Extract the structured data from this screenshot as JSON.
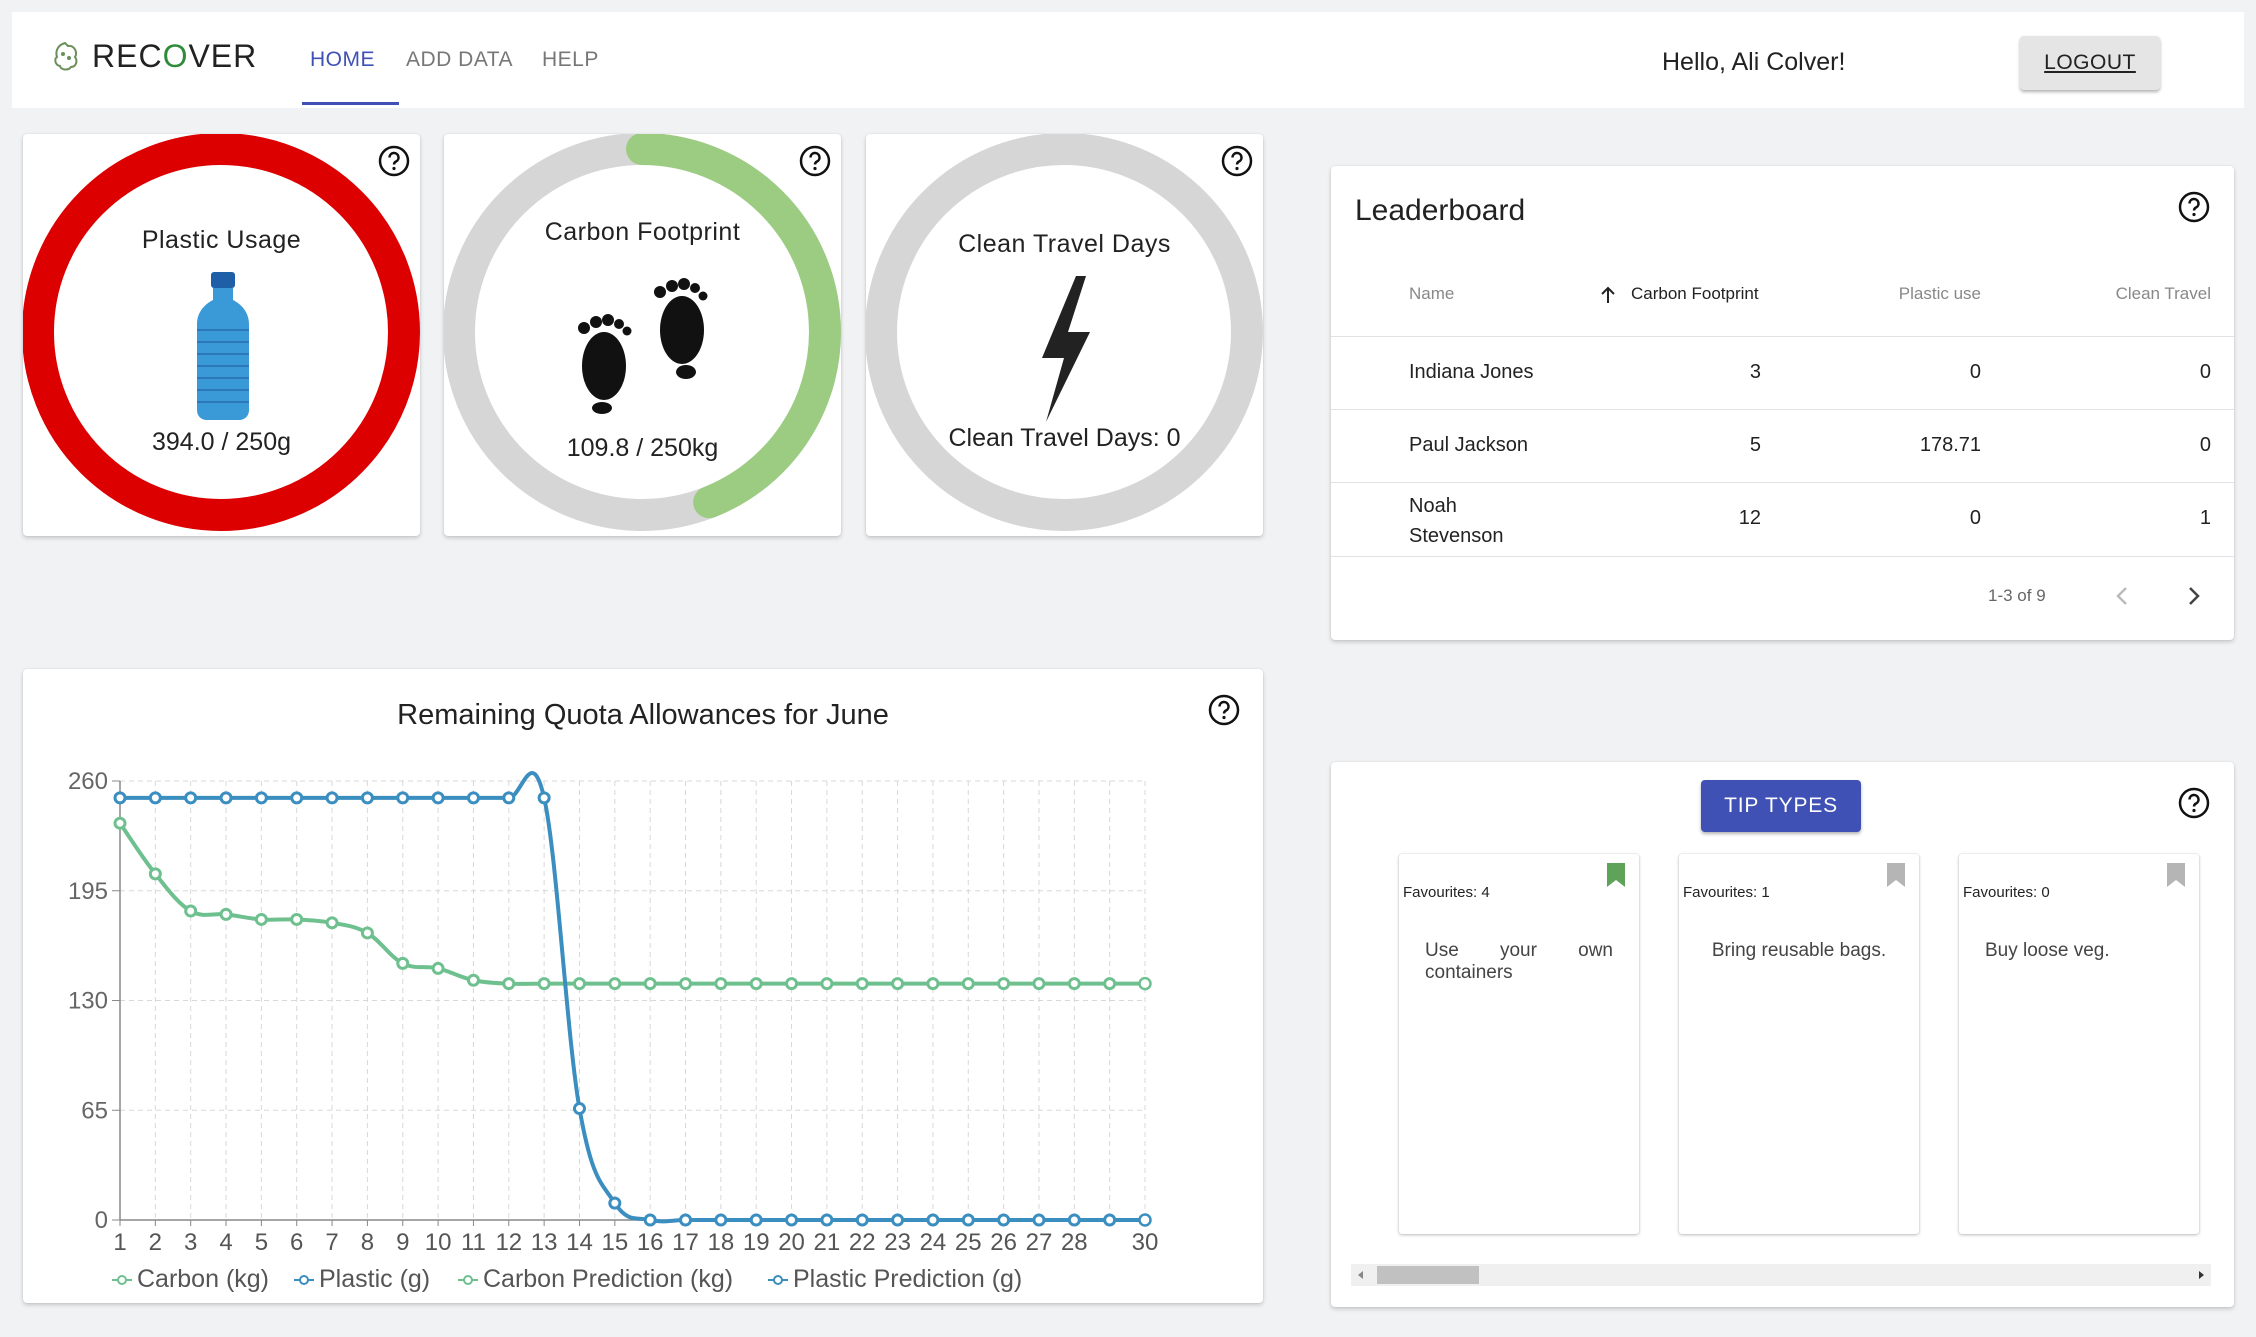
{
  "header": {
    "brand_prefix": "REC",
    "brand_mid": "O",
    "brand_suffix": "VER",
    "nav": {
      "home": "HOME",
      "add_data": "ADD DATA",
      "help": "HELP"
    },
    "greeting": "Hello, Ali Colver!",
    "logout": "LOGOUT"
  },
  "gauges": {
    "plastic": {
      "title": "Plastic Usage",
      "value": "394.0 / 250g",
      "fraction": 1.0,
      "color": "#dd0000"
    },
    "carbon": {
      "title": "Carbon Footprint",
      "value": "109.8 / 250kg",
      "fraction": 0.44,
      "color": "#9ccc81"
    },
    "clean": {
      "title": "Clean Travel Days",
      "value": "Clean Travel Days: 0",
      "fraction": 0.0,
      "color": "#d6d6d6"
    }
  },
  "leaderboard": {
    "title": "Leaderboard",
    "columns": {
      "name": "Name",
      "carbon": "Carbon Footprint",
      "plastic": "Plastic use",
      "clean": "Clean Travel"
    },
    "rows": [
      {
        "name": "Indiana Jones",
        "name2": "",
        "carbon": "3",
        "plastic": "0",
        "clean": "0"
      },
      {
        "name": "Paul Jackson",
        "name2": "",
        "carbon": "5",
        "plastic": "178.71",
        "clean": "0"
      },
      {
        "name": "Noah",
        "name2": "Stevenson",
        "carbon": "12",
        "plastic": "0",
        "clean": "1"
      }
    ],
    "pagination": "1-3 of 9"
  },
  "chart": {
    "title": "Remaining Quota Allowances for June",
    "legend": [
      "Carbon (kg)",
      "Plastic (g)",
      "Carbon Prediction (kg)",
      "Plastic Prediction (g)"
    ],
    "colors": {
      "carbon": "#6fc08f",
      "plastic": "#3b8ec0"
    }
  },
  "chart_data": {
    "type": "line",
    "title": "Remaining Quota Allowances for June",
    "x": [
      1,
      2,
      3,
      4,
      5,
      6,
      7,
      8,
      9,
      10,
      11,
      12,
      13,
      14,
      15,
      16,
      17,
      18,
      19,
      20,
      21,
      22,
      23,
      24,
      25,
      26,
      27,
      28,
      29,
      30
    ],
    "x_tick_labels": [
      "1",
      "2",
      "3",
      "4",
      "5",
      "6",
      "7",
      "8",
      "9",
      "10",
      "11",
      "12",
      "13",
      "14",
      "15",
      "16",
      "17",
      "18",
      "19",
      "20",
      "21",
      "22",
      "23",
      "24",
      "25",
      "26",
      "27",
      "28",
      "",
      "30"
    ],
    "ylim": [
      0,
      260
    ],
    "y_ticks": [
      0,
      65,
      130,
      195,
      260
    ],
    "grid": true,
    "legend_position": "bottom",
    "series": [
      {
        "name": "Carbon (kg)",
        "color": "#6fc08f",
        "values": [
          235,
          205,
          183,
          181,
          178,
          178,
          176,
          170,
          152,
          149,
          142,
          140,
          140,
          140,
          140,
          140,
          140,
          140,
          140,
          140,
          140,
          140,
          140,
          140,
          140,
          140,
          140,
          140,
          140,
          140
        ]
      },
      {
        "name": "Plastic (g)",
        "color": "#3b8ec0",
        "values": [
          250,
          250,
          250,
          250,
          250,
          250,
          250,
          250,
          250,
          250,
          250,
          250,
          250,
          66,
          10,
          0,
          0,
          0,
          0,
          0,
          0,
          0,
          0,
          0,
          0,
          0,
          0,
          0,
          0,
          0
        ]
      },
      {
        "name": "Carbon Prediction (kg)",
        "color": "#6fc08f",
        "values": []
      },
      {
        "name": "Plastic Prediction (g)",
        "color": "#3b8ec0",
        "values": []
      }
    ]
  },
  "tips": {
    "button": "TIP TYPES",
    "cards": [
      {
        "favourites": "Favourites: 4",
        "text": "Use your own containers",
        "bookmarked": true
      },
      {
        "favourites": "Favourites: 1",
        "text": "Bring reusable bags.",
        "bookmarked": false
      },
      {
        "favourites": "Favourites: 0",
        "text": "Buy loose veg.",
        "bookmarked": false
      }
    ]
  }
}
